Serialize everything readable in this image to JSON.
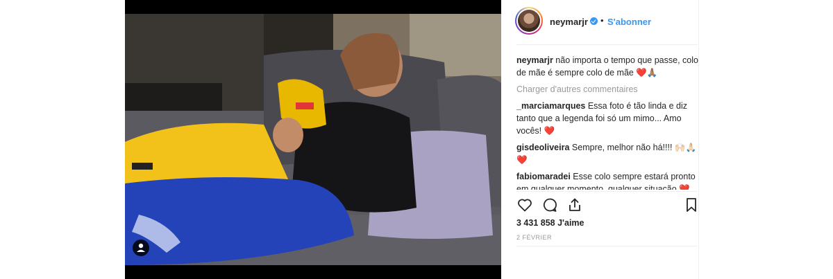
{
  "post": {
    "username": "neymarjr",
    "separator": "•",
    "follow_label": "S'abonner",
    "caption": {
      "user": "neymarjr",
      "text": " não importa o tempo que passe, colo de mãe é sempre colo de mãe ",
      "emoji": "❤️🙏🏽"
    },
    "load_more_label": "Charger d'autres commentaires",
    "comments": [
      {
        "user": "_marciamarques",
        "text": " Essa foto é tão linda e diz tanto que a legenda foi só um mimo... Amo vocês! ",
        "emoji": "❤️"
      },
      {
        "user": "gisdeoliveira",
        "text": " Sempre, melhor não há!!!! ",
        "emoji": "🙌🏻🙏🏻❤️"
      },
      {
        "user": "fabiomaradei",
        "text": " Esse colo sempre estará pronto em qualquer momento, qualquer situação ",
        "emoji": "❤️"
      }
    ],
    "likes": "3 431 858 J'aime",
    "date": "2 FÉVRIER"
  },
  "icons": {
    "like": "heart-outline-icon",
    "comment": "comment-bubble-icon",
    "share": "share-upload-icon",
    "save": "bookmark-icon",
    "user_tag": "user-tag-icon",
    "verified": "verified-badge-icon"
  },
  "colors": {
    "link_blue": "#3897f0",
    "text": "#262626",
    "muted": "#999999",
    "heart": "#ed4956"
  }
}
